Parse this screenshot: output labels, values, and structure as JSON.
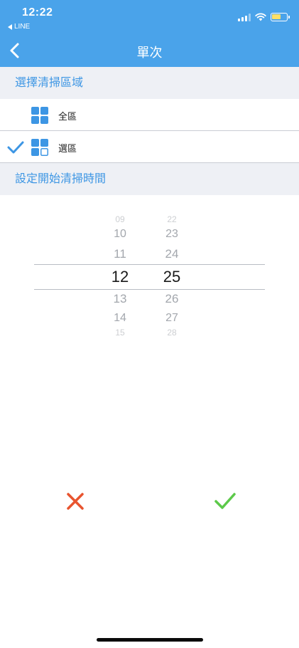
{
  "status_bar": {
    "time": "12:22",
    "back_app": "LINE",
    "battery_color": "#ffe066"
  },
  "nav": {
    "title": "單次",
    "back_icon": "chevron-left-icon"
  },
  "area_section": {
    "title": "選擇清掃區域",
    "options": [
      {
        "label": "全區",
        "icon": "grid-full-icon",
        "selected": false
      },
      {
        "label": "選區",
        "icon": "grid-partial-icon",
        "selected": true
      }
    ]
  },
  "time_section": {
    "title": "設定開始清掃時間",
    "hours": [
      "09",
      "10",
      "11",
      "12",
      "13",
      "14",
      "15"
    ],
    "minutes": [
      "22",
      "23",
      "24",
      "25",
      "26",
      "27",
      "28"
    ],
    "selected_hour": "12",
    "selected_minute": "25"
  },
  "actions": {
    "cancel_icon": "close-icon",
    "cancel_color": "#e8542f",
    "confirm_icon": "check-icon",
    "confirm_color": "#5cc94a"
  },
  "colors": {
    "accent": "#4aa3ea",
    "section_text": "#3d96e4"
  }
}
